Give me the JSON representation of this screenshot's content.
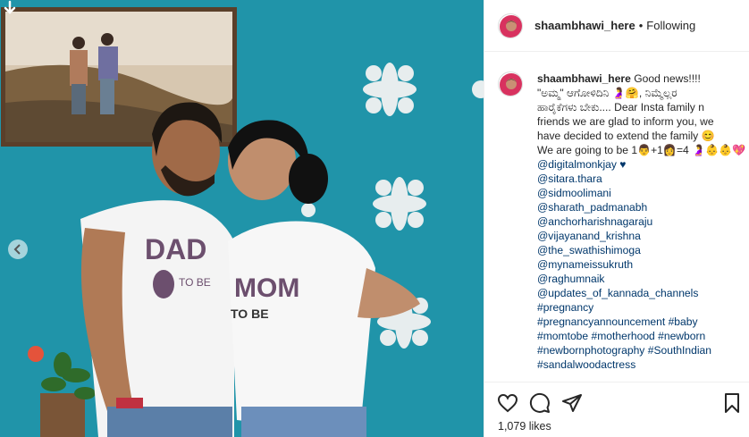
{
  "post": {
    "username": "shaambhawi_here",
    "separator": "•",
    "follow_status": "Following"
  },
  "caption": {
    "username": "shaambhawi_here",
    "lines": [
      " Good news!!!!",
      "\"ಅಮ್ಮ\" ಆಗೋಳಿದಿನಿ 🤰🤗, ನಿಮ್ಮೆಲ್ಲರ",
      "ಹಾರೈಕೆಗಳು ಬೇಕು.... Dear Insta family n",
      "friends we are glad to inform you, we",
      "have decided to extend the family 😊",
      "We are going to be 1👨+1👩=4 🤰👶👶💖"
    ],
    "mention_lines": [
      "@digitalmonkjay ♥",
      "@sitara.thara",
      "@sidmoolimani",
      "@sharath_padmanabh",
      "@anchorharishnagaraju",
      "@vijayanand_krishna",
      "@the_swathishimoga",
      "@mynameissukruth",
      "@raghumnaik",
      "@updates_of_kannada_channels",
      "#pregnancy",
      "#pregnancyannouncement #baby",
      "#momtobe #motherhood #newborn",
      "#newbornphotography #SouthIndian",
      "#sandalwoodactress"
    ]
  },
  "actions": {
    "likes": "1,079 likes"
  },
  "photo": {
    "shirt_left_text": "DAD",
    "shirt_left_sub": "TO BE",
    "shirt_right_text": "MOM",
    "shirt_right_sub": "TO BE"
  },
  "colors": {
    "wall": "#1c8fa4",
    "link": "#00376b",
    "border": "#efefef"
  },
  "icons": [
    "arrow-down-icon",
    "chevron-left-icon",
    "heart-icon",
    "comment-icon",
    "share-icon",
    "bookmark-icon"
  ]
}
